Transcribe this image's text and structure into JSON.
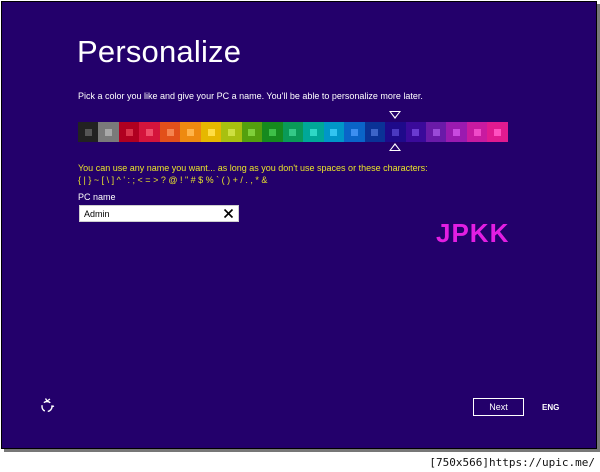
{
  "colors": {
    "background": "#23006b",
    "hint_text": "#e9e32a",
    "watermark": "#e21ee2"
  },
  "page": {
    "title": "Personalize",
    "subtitle": "Pick a color you like and give your PC a name. You'll be able to personalize more later."
  },
  "swatches": [
    {
      "bg": "#222222",
      "dot": "#555555"
    },
    {
      "bg": "#7a7a7a",
      "dot": "#a8a8a8"
    },
    {
      "bg": "#b00020",
      "dot": "#d9334a"
    },
    {
      "bg": "#d4143c",
      "dot": "#f04d6a"
    },
    {
      "bg": "#e2501a",
      "dot": "#f58450"
    },
    {
      "bg": "#ee8a10",
      "dot": "#ffb44a"
    },
    {
      "bg": "#e6b800",
      "dot": "#ffdd44"
    },
    {
      "bg": "#a8c010",
      "dot": "#cde040"
    },
    {
      "bg": "#54a00e",
      "dot": "#7fd03a"
    },
    {
      "bg": "#168a1e",
      "dot": "#3ebf48"
    },
    {
      "bg": "#0a9a58",
      "dot": "#34c987"
    },
    {
      "bg": "#00a898",
      "dot": "#2ed8c6"
    },
    {
      "bg": "#0096c8",
      "dot": "#32c4f0"
    },
    {
      "bg": "#0a64c8",
      "dot": "#3c8ef0"
    },
    {
      "bg": "#0a3296",
      "dot": "#3c64c8"
    },
    {
      "bg": "#1e0a8a",
      "dot": "#4a38c0"
    },
    {
      "bg": "#3a0a9a",
      "dot": "#6a3ad0"
    },
    {
      "bg": "#6a1aa8",
      "dot": "#9a4ad8"
    },
    {
      "bg": "#9a1ab0",
      "dot": "#c84ae0"
    },
    {
      "bg": "#c81aa0",
      "dot": "#f04ac8"
    },
    {
      "bg": "#e01a90",
      "dot": "#ff50c0"
    }
  ],
  "selected_swatch_index": 15,
  "hint": {
    "line1": "You can use any name you want... as long as you don't use spaces or these characters:",
    "line2": "{ | } ~ [ \\ ] ^ ' : ; < = > ? @ ! \" # $ % ` ( ) + / . , * &"
  },
  "pc_name": {
    "label": "PC name",
    "value": "Admin"
  },
  "watermark": "JPKK",
  "icons": {
    "ease_of_access": "ease-of-access-icon",
    "clear": "clear-icon"
  },
  "buttons": {
    "next": "Next"
  },
  "language": "ENG",
  "footer_note": "[750x566]https://upic.me/"
}
